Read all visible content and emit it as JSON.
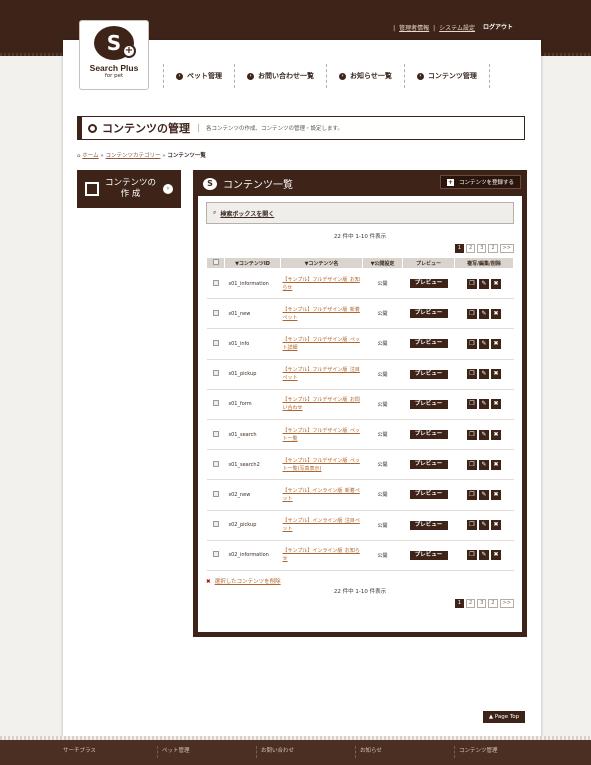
{
  "header": {
    "links": [
      "管理者情報",
      "システム設定"
    ],
    "logout": "ログアウト",
    "logo_title": "Search Plus",
    "logo_sub": "for pet",
    "nav": [
      "ペット管理",
      "お問い合わせ一覧",
      "お知らせ一覧",
      "コンテンツ管理"
    ]
  },
  "page": {
    "title": "コンテンツの管理",
    "desc": "各コンテンツの作成、コンテンツの管理・設定します。",
    "breadcrumb": [
      "ホーム",
      "コンテンツカテゴリー",
      "コンテンツ一覧"
    ]
  },
  "side": {
    "button_line1": "コンテンツの",
    "button_line2": "作 成"
  },
  "panel": {
    "title": "コンテンツ一覧",
    "register": "コンテンツを登録する",
    "search_toggle": "検索ボックスを開く",
    "count": "22 件中 1-10 件表示",
    "pager": [
      "1",
      "2",
      "3",
      "2",
      ">>"
    ],
    "columns": [
      "",
      "▼コンテンツID",
      "▼コンテンツ名",
      "▼公開設定",
      "プレビュー",
      "複写/編集/削除"
    ],
    "rows": [
      {
        "id": "s01_information",
        "name": "【サンプル】フルデザイン版_お知らせ",
        "status": "公開",
        "preview": "プレビュー"
      },
      {
        "id": "s01_new",
        "name": "【サンプル】フルデザイン版_新着ペット",
        "status": "公開",
        "preview": "プレビュー"
      },
      {
        "id": "s01_info",
        "name": "【サンプル】フルデザイン版_ペット詳細",
        "status": "公開",
        "preview": "プレビュー"
      },
      {
        "id": "s01_pickup",
        "name": "【サンプル】フルデザイン版_注目ペット",
        "status": "公開",
        "preview": "プレビュー"
      },
      {
        "id": "s01_form",
        "name": "【サンプル】フルデザイン版_お問い合わせ",
        "status": "公開",
        "preview": "プレビュー"
      },
      {
        "id": "s01_search",
        "name": "【サンプル】フルデザイン版_ペット一覧",
        "status": "公開",
        "preview": "プレビュー"
      },
      {
        "id": "s01_search2",
        "name": "【サンプル】フルデザイン版_ペット一覧(写真表示)",
        "status": "公開",
        "preview": "プレビュー"
      },
      {
        "id": "s02_new",
        "name": "【サンプル】インライン版_新着ペット",
        "status": "公開",
        "preview": "プレビュー"
      },
      {
        "id": "s02_pickup",
        "name": "【サンプル】インライン版_注目ペット",
        "status": "公開",
        "preview": "プレビュー"
      },
      {
        "id": "s02_information",
        "name": "【サンプル】インライン版_お知らせ",
        "status": "公開",
        "preview": "プレビュー"
      }
    ],
    "delete_selected": "選択したコンテンツを削除",
    "count_bottom": "22 件中 1-10 件表示"
  },
  "pagetop": "Page Top",
  "footer": [
    "サーチプラス",
    "ペット管理",
    "お問い合わせ",
    "お知らせ",
    "コンテンツ管理"
  ],
  "colors": {
    "brand": "#3e2418",
    "link": "#b0662e"
  }
}
